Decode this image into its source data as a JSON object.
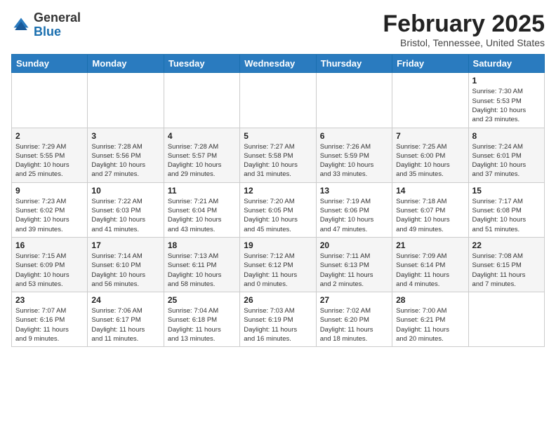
{
  "header": {
    "logo_general": "General",
    "logo_blue": "Blue",
    "month_title": "February 2025",
    "location": "Bristol, Tennessee, United States"
  },
  "weekdays": [
    "Sunday",
    "Monday",
    "Tuesday",
    "Wednesday",
    "Thursday",
    "Friday",
    "Saturday"
  ],
  "weeks": [
    [
      {
        "day": "",
        "info": ""
      },
      {
        "day": "",
        "info": ""
      },
      {
        "day": "",
        "info": ""
      },
      {
        "day": "",
        "info": ""
      },
      {
        "day": "",
        "info": ""
      },
      {
        "day": "",
        "info": ""
      },
      {
        "day": "1",
        "info": "Sunrise: 7:30 AM\nSunset: 5:53 PM\nDaylight: 10 hours\nand 23 minutes."
      }
    ],
    [
      {
        "day": "2",
        "info": "Sunrise: 7:29 AM\nSunset: 5:55 PM\nDaylight: 10 hours\nand 25 minutes."
      },
      {
        "day": "3",
        "info": "Sunrise: 7:28 AM\nSunset: 5:56 PM\nDaylight: 10 hours\nand 27 minutes."
      },
      {
        "day": "4",
        "info": "Sunrise: 7:28 AM\nSunset: 5:57 PM\nDaylight: 10 hours\nand 29 minutes."
      },
      {
        "day": "5",
        "info": "Sunrise: 7:27 AM\nSunset: 5:58 PM\nDaylight: 10 hours\nand 31 minutes."
      },
      {
        "day": "6",
        "info": "Sunrise: 7:26 AM\nSunset: 5:59 PM\nDaylight: 10 hours\nand 33 minutes."
      },
      {
        "day": "7",
        "info": "Sunrise: 7:25 AM\nSunset: 6:00 PM\nDaylight: 10 hours\nand 35 minutes."
      },
      {
        "day": "8",
        "info": "Sunrise: 7:24 AM\nSunset: 6:01 PM\nDaylight: 10 hours\nand 37 minutes."
      }
    ],
    [
      {
        "day": "9",
        "info": "Sunrise: 7:23 AM\nSunset: 6:02 PM\nDaylight: 10 hours\nand 39 minutes."
      },
      {
        "day": "10",
        "info": "Sunrise: 7:22 AM\nSunset: 6:03 PM\nDaylight: 10 hours\nand 41 minutes."
      },
      {
        "day": "11",
        "info": "Sunrise: 7:21 AM\nSunset: 6:04 PM\nDaylight: 10 hours\nand 43 minutes."
      },
      {
        "day": "12",
        "info": "Sunrise: 7:20 AM\nSunset: 6:05 PM\nDaylight: 10 hours\nand 45 minutes."
      },
      {
        "day": "13",
        "info": "Sunrise: 7:19 AM\nSunset: 6:06 PM\nDaylight: 10 hours\nand 47 minutes."
      },
      {
        "day": "14",
        "info": "Sunrise: 7:18 AM\nSunset: 6:07 PM\nDaylight: 10 hours\nand 49 minutes."
      },
      {
        "day": "15",
        "info": "Sunrise: 7:17 AM\nSunset: 6:08 PM\nDaylight: 10 hours\nand 51 minutes."
      }
    ],
    [
      {
        "day": "16",
        "info": "Sunrise: 7:15 AM\nSunset: 6:09 PM\nDaylight: 10 hours\nand 53 minutes."
      },
      {
        "day": "17",
        "info": "Sunrise: 7:14 AM\nSunset: 6:10 PM\nDaylight: 10 hours\nand 56 minutes."
      },
      {
        "day": "18",
        "info": "Sunrise: 7:13 AM\nSunset: 6:11 PM\nDaylight: 10 hours\nand 58 minutes."
      },
      {
        "day": "19",
        "info": "Sunrise: 7:12 AM\nSunset: 6:12 PM\nDaylight: 11 hours\nand 0 minutes."
      },
      {
        "day": "20",
        "info": "Sunrise: 7:11 AM\nSunset: 6:13 PM\nDaylight: 11 hours\nand 2 minutes."
      },
      {
        "day": "21",
        "info": "Sunrise: 7:09 AM\nSunset: 6:14 PM\nDaylight: 11 hours\nand 4 minutes."
      },
      {
        "day": "22",
        "info": "Sunrise: 7:08 AM\nSunset: 6:15 PM\nDaylight: 11 hours\nand 7 minutes."
      }
    ],
    [
      {
        "day": "23",
        "info": "Sunrise: 7:07 AM\nSunset: 6:16 PM\nDaylight: 11 hours\nand 9 minutes."
      },
      {
        "day": "24",
        "info": "Sunrise: 7:06 AM\nSunset: 6:17 PM\nDaylight: 11 hours\nand 11 minutes."
      },
      {
        "day": "25",
        "info": "Sunrise: 7:04 AM\nSunset: 6:18 PM\nDaylight: 11 hours\nand 13 minutes."
      },
      {
        "day": "26",
        "info": "Sunrise: 7:03 AM\nSunset: 6:19 PM\nDaylight: 11 hours\nand 16 minutes."
      },
      {
        "day": "27",
        "info": "Sunrise: 7:02 AM\nSunset: 6:20 PM\nDaylight: 11 hours\nand 18 minutes."
      },
      {
        "day": "28",
        "info": "Sunrise: 7:00 AM\nSunset: 6:21 PM\nDaylight: 11 hours\nand 20 minutes."
      },
      {
        "day": "",
        "info": ""
      }
    ]
  ]
}
